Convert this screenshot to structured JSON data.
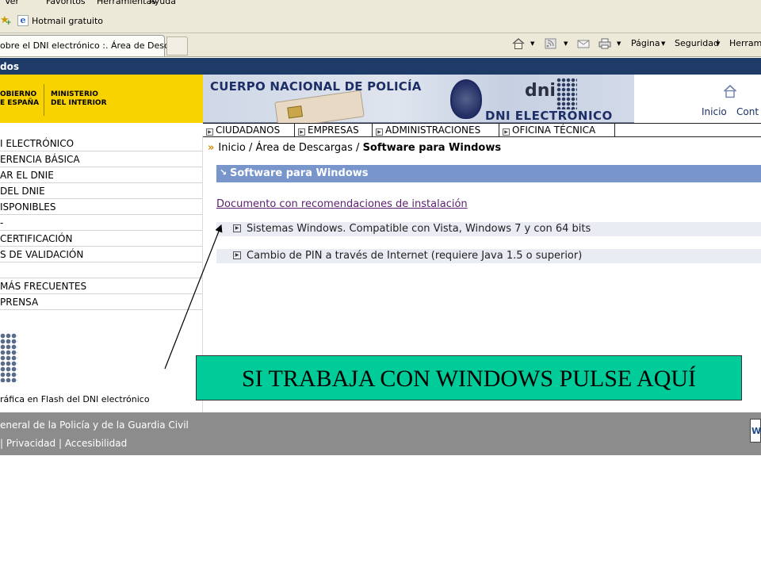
{
  "browser": {
    "menu": [
      "Ver",
      "Favoritos",
      "Herramientas",
      "Ayuda"
    ],
    "favorites": {
      "link": "Hotmail gratuito"
    },
    "tab_title": "obre el DNI electrónico :. Área de Desc...",
    "toolbar": {
      "page": "Página",
      "security": "Seguridad",
      "tools": "Herrami"
    }
  },
  "page": {
    "title_strip": "dos",
    "gov": {
      "left": [
        "OBIERNO",
        "E ESPAÑA"
      ],
      "right": [
        "MINISTERIO",
        "DEL INTERIOR"
      ]
    },
    "banner": {
      "agency": "CUERPO NACIONAL DE POLICÍA",
      "logo": "dni",
      "product": "DNI ELECTRÓNICO"
    },
    "top_nav": {
      "home": "Inicio",
      "contact": "Cont"
    },
    "nav_tabs": [
      "CIUDADANOS",
      "EMPRESAS",
      "ADMINISTRACIONES",
      "OFICINA TÉCNICA"
    ],
    "sidebar": [
      "I ELECTRÓNICO",
      "ERENCIA BÁSICA",
      "AR EL DNIE",
      "DEL DNIE",
      "ISPONIBLES",
      "-",
      "CERTIFICACIÓN",
      "S DE VALIDACIÓN",
      "",
      "MÁS FRECUENTES",
      "PRENSA"
    ],
    "flash_text": "ráfica en Flash del DNI electrónico",
    "breadcrumb": {
      "home": "Inicio",
      "section": "Área de Descargas",
      "current": "Software para Windows"
    },
    "section_title": "Software para Windows",
    "doc_link": "Documento con recomendaciones de instalación",
    "downloads": [
      "Sistemas Windows. Compatible con Vista, Windows 7 y con 64 bits",
      "Cambio de PIN a través de Internet (requiere Java 1.5 o superior)"
    ],
    "footer": {
      "line1": "eneral de la Policía y de la Guardia Civil",
      "line2_a": "Privacidad",
      "line2_b": "Accesibilidad",
      "badge": "W"
    }
  },
  "annotation": {
    "callout": "SI TRABAJA CON WINDOWS PULSE AQUÍ",
    "color": "#00cc99"
  }
}
